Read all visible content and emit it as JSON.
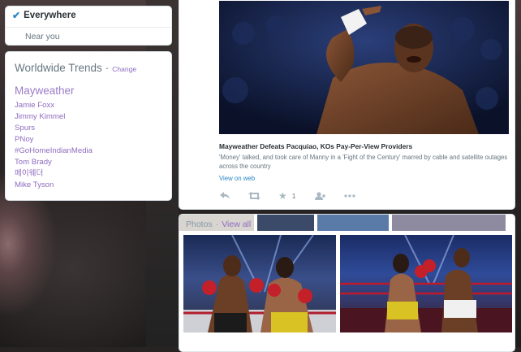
{
  "location": {
    "selected": "Everywhere",
    "other": "Near you"
  },
  "trends": {
    "title": "Worldwide Trends",
    "separator": "·",
    "change_label": "Change",
    "items": [
      "Mayweather",
      "Jamie Foxx",
      "Jimmy Kimmel",
      "Spurs",
      "PNoy",
      "#GoHomeIndianMedia",
      "Tom Brady",
      "메이웨더",
      "Mike Tyson"
    ]
  },
  "tweet": {
    "headline": "Mayweather Defeats Pacquiao, KOs Pay-Per-View Providers",
    "description": "'Money' talked, and took care of Manny in a 'Fight of the Century' marred by cable and satellite outages across the country",
    "link_label": "View on web",
    "favorite_count": "1",
    "icons": {
      "reply": "reply-icon",
      "retweet": "retweet-icon",
      "favorite": "star-icon",
      "follow": "follow-icon",
      "more": "more-icon"
    }
  },
  "photos": {
    "title": "Photos",
    "separator": "·",
    "view_all": "View all"
  },
  "colors": {
    "accent": "#8e6cbf",
    "link": "#2a86c8",
    "check": "#2a86c8"
  }
}
